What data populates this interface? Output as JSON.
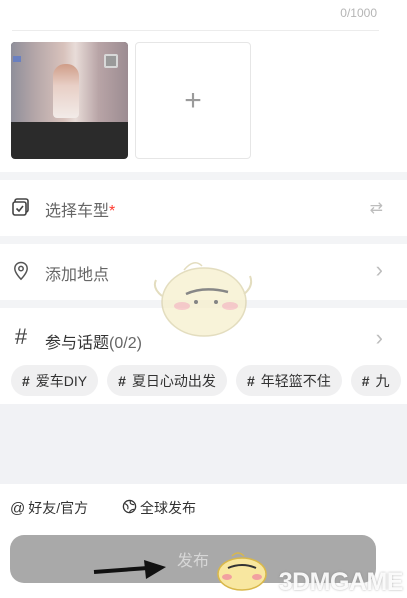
{
  "text_counter": "0/1000",
  "images": {
    "add_label": "+"
  },
  "car_row": {
    "label": "选择车型",
    "required_mark": "*",
    "icon": "checkbox-icon",
    "trail_icon": "swap-icon",
    "trail_glyph": "⇄"
  },
  "location_row": {
    "label": "添加地点",
    "icon": "location-pin-icon",
    "trail_glyph": "›"
  },
  "topic_row": {
    "icon": "hash-icon",
    "icon_glyph": "#",
    "title": "参与话题",
    "count": "(0/2)",
    "trail_glyph": "›",
    "chips": [
      {
        "hash": "#",
        "label": "爱车DIY"
      },
      {
        "hash": "#",
        "label": "夏日心动出发"
      },
      {
        "hash": "#",
        "label": "年轻篮不住"
      },
      {
        "hash": "#",
        "label": "九"
      }
    ]
  },
  "share": {
    "friends_icon": "@",
    "friends_label": "好友/官方",
    "global_icon": "🌐",
    "global_label": "全球发布"
  },
  "publish": {
    "label": "发布"
  },
  "watermark": "3DMGAME",
  "colors": {
    "required": "#ff3b30",
    "publish_disabled": "#a9a9a9"
  }
}
